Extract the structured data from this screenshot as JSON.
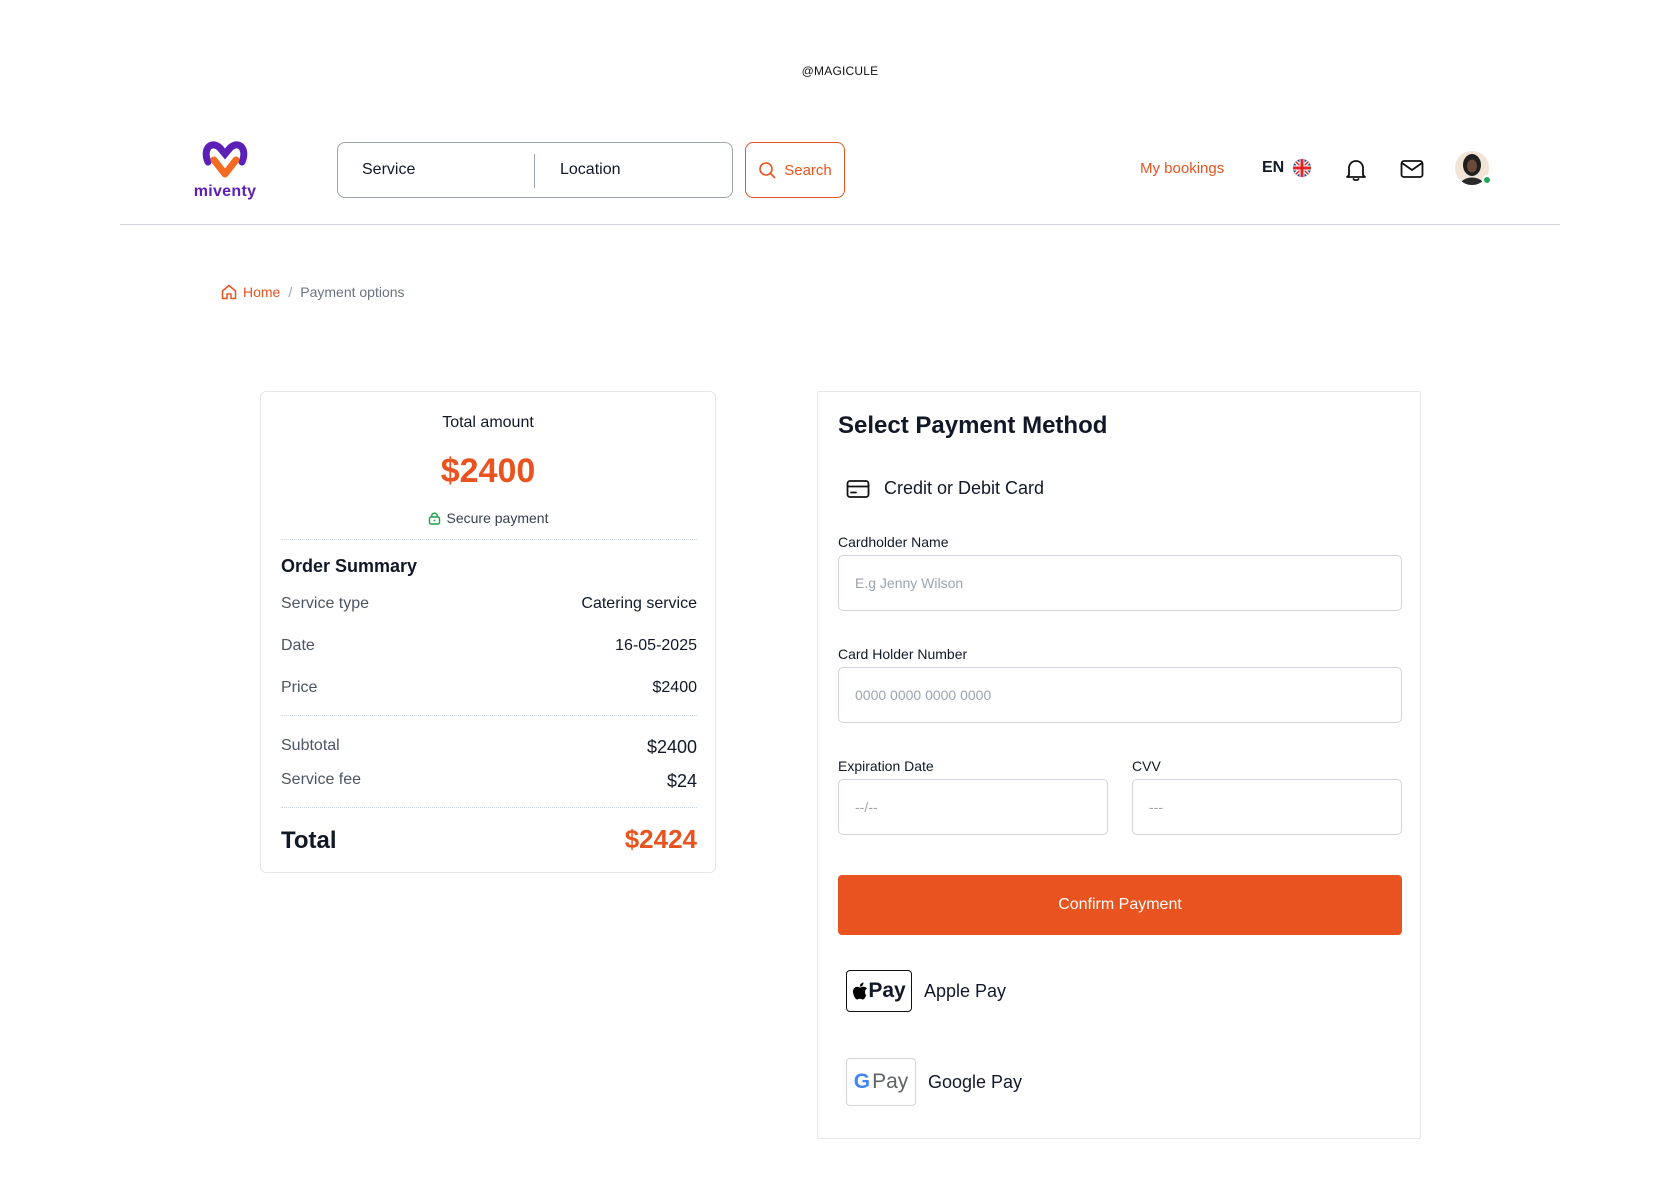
{
  "watermark": "@MAGICULE",
  "header": {
    "logo_text": "miventy",
    "search": {
      "service_value": "Service",
      "location_value": "Location",
      "button_label": "Search"
    },
    "my_bookings": "My bookings",
    "language": "EN"
  },
  "breadcrumb": {
    "home": "Home",
    "separator": "/",
    "current": "Payment options"
  },
  "summary": {
    "total_label": "Total amount",
    "total_amount": "$2400",
    "secure_label": "Secure payment",
    "order_title": "Order Summary",
    "items": [
      {
        "label": "Service type",
        "value": "Catering service"
      },
      {
        "label": "Date",
        "value": "16-05-2025"
      },
      {
        "label": "Price",
        "value": "$2400"
      }
    ],
    "subtotal_label": "Subtotal",
    "subtotal_value": "$2400",
    "fee_label": "Service fee",
    "fee_value": "$24",
    "grand_label": "Total",
    "grand_value": "$2424"
  },
  "payment": {
    "title": "Select Payment Method",
    "method_label": "Credit or Debit Card",
    "cardholder_label": "Cardholder Name",
    "cardholder_placeholder": "E.g Jenny Wilson",
    "number_label": "Card Holder Number",
    "number_placeholder": "0000 0000 0000 0000",
    "expiry_label": "Expiration Date",
    "expiry_placeholder": "--/--",
    "cvv_label": "CVV",
    "cvv_placeholder": "---",
    "confirm_label": "Confirm Payment",
    "apple_badge": "Pay",
    "apple_label": "Apple Pay",
    "google_badge_g": "G",
    "google_badge_pay": "Pay",
    "google_label": "Google Pay"
  },
  "colors": {
    "accent": "#e8531f",
    "brand_purple": "#5b21b6",
    "online": "#22a55b"
  }
}
